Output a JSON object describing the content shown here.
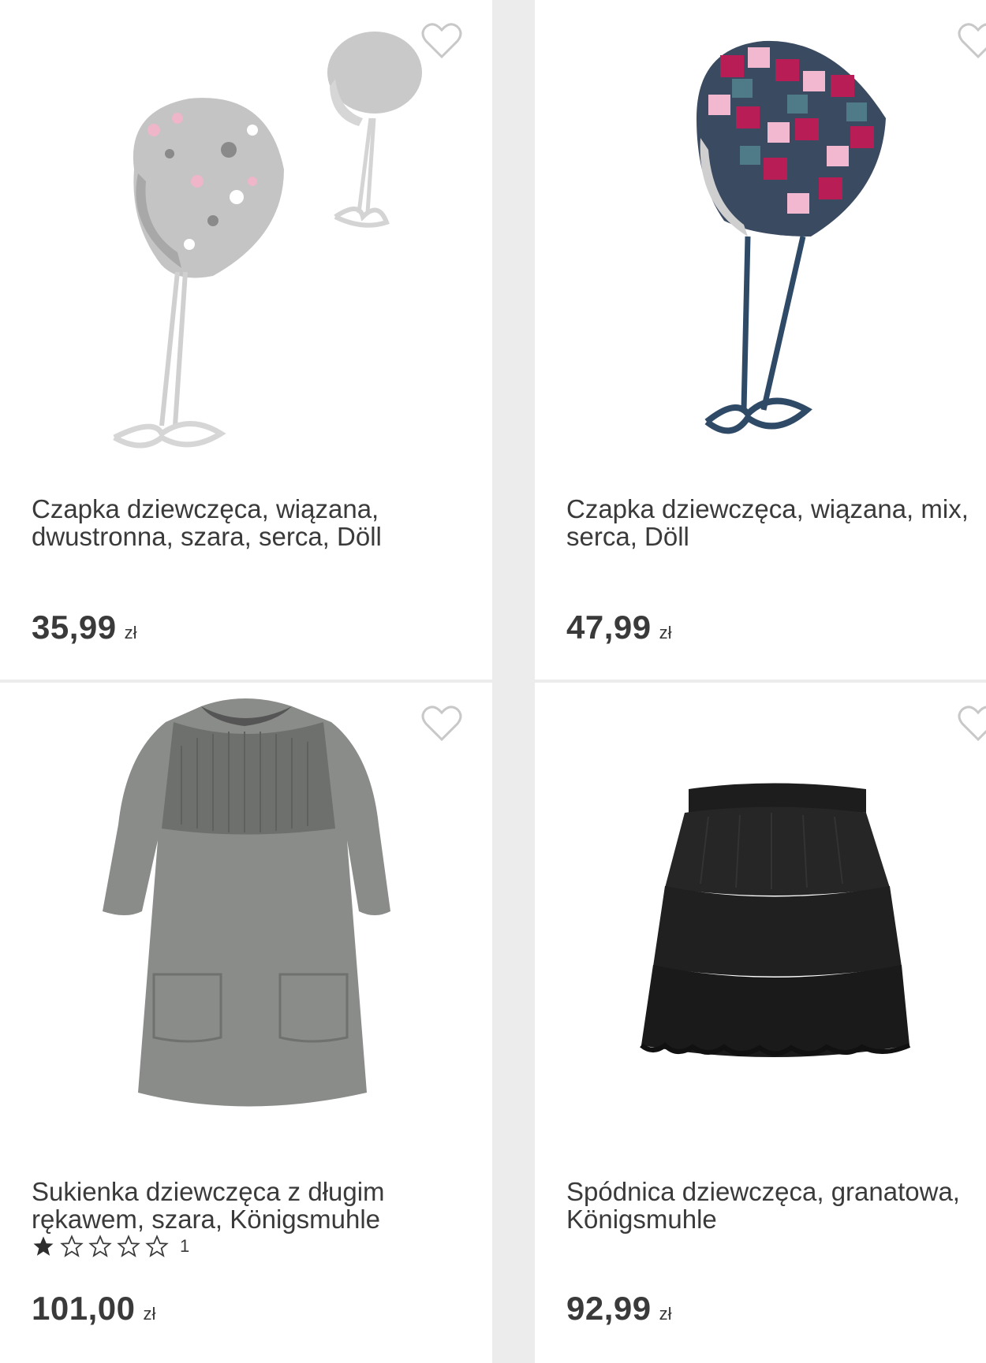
{
  "products": [
    {
      "title": "Czapka dziewczęca, wiązana, dwustronna, szara, serca, Döll",
      "price": "35,99",
      "currency": "zł",
      "image_icon": "baby-hat-gray-hearts-image",
      "favorite_icon": "heart-outline-icon"
    },
    {
      "title": "Czapka dziewczęca, wiązana, mix, serca, Döll",
      "price": "47,99",
      "currency": "zł",
      "image_icon": "baby-hat-multicolor-hearts-image",
      "favorite_icon": "heart-outline-icon"
    },
    {
      "title": "Sukienka dziewczęca z długim rękawem, szara, Königsmuhle",
      "price": "101,00",
      "currency": "zł",
      "rating": {
        "filled_stars": 1,
        "total_stars": 5,
        "count": "1"
      },
      "image_icon": "gray-knit-dress-image",
      "favorite_icon": "heart-outline-icon"
    },
    {
      "title": "Spódnica dziewczęca, granatowa, Königsmuhle",
      "price": "92,99",
      "currency": "zł",
      "image_icon": "black-tulle-skirt-image",
      "favorite_icon": "heart-outline-icon"
    }
  ],
  "colors": {
    "background": "#ececec",
    "card": "#ffffff",
    "text": "#3a3a3a",
    "heart_outline": "#c8c8c8"
  }
}
